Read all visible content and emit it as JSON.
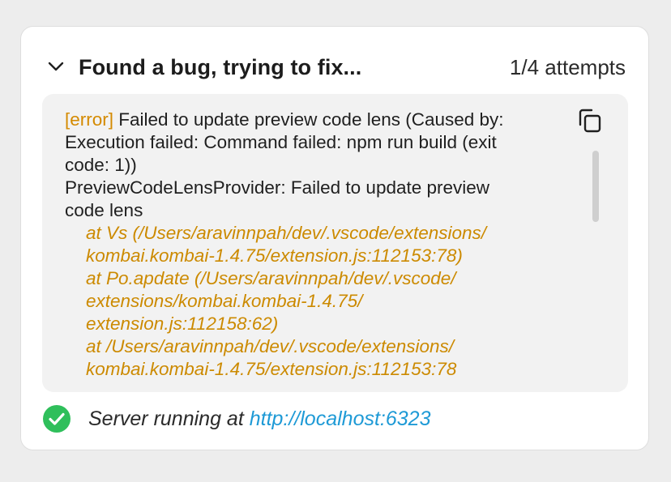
{
  "header": {
    "title": "Found a bug, trying to fix...",
    "attempts": "1/4 attempts"
  },
  "log": {
    "error_tag": "[error]",
    "message_lines": [
      " Failed to update preview code lens (Caused by:",
      "Execution failed: Command failed: npm run build (exit",
      "code: 1))",
      "PreviewCodeLensProvider: Failed to update preview",
      "code lens"
    ],
    "trace_lines": [
      "at Vs (/Users/aravinnpah/dev/.vscode/extensions/",
      "kombai.kombai-1.4.75/extension.js:112153:78)",
      "at Po.apdate (/Users/aravinnpah/dev/.vscode/",
      "extensions/kombai.kombai-1.4.75/",
      "extension.js:112158:62)",
      "at /Users/aravinnpah/dev/.vscode/extensions/",
      "kombai.kombai-1.4.75/extension.js:112153:78"
    ]
  },
  "status": {
    "prefix": "Server running at ",
    "link": "http://localhost:6323"
  },
  "icons": {
    "collapse": "chevron-down-icon",
    "copy": "copy-icon",
    "status": "check-circle-icon"
  },
  "colors": {
    "error": "#d48a00",
    "trace": "#cc8a00",
    "link": "#1e9ad6",
    "success": "#2fbf5b"
  }
}
